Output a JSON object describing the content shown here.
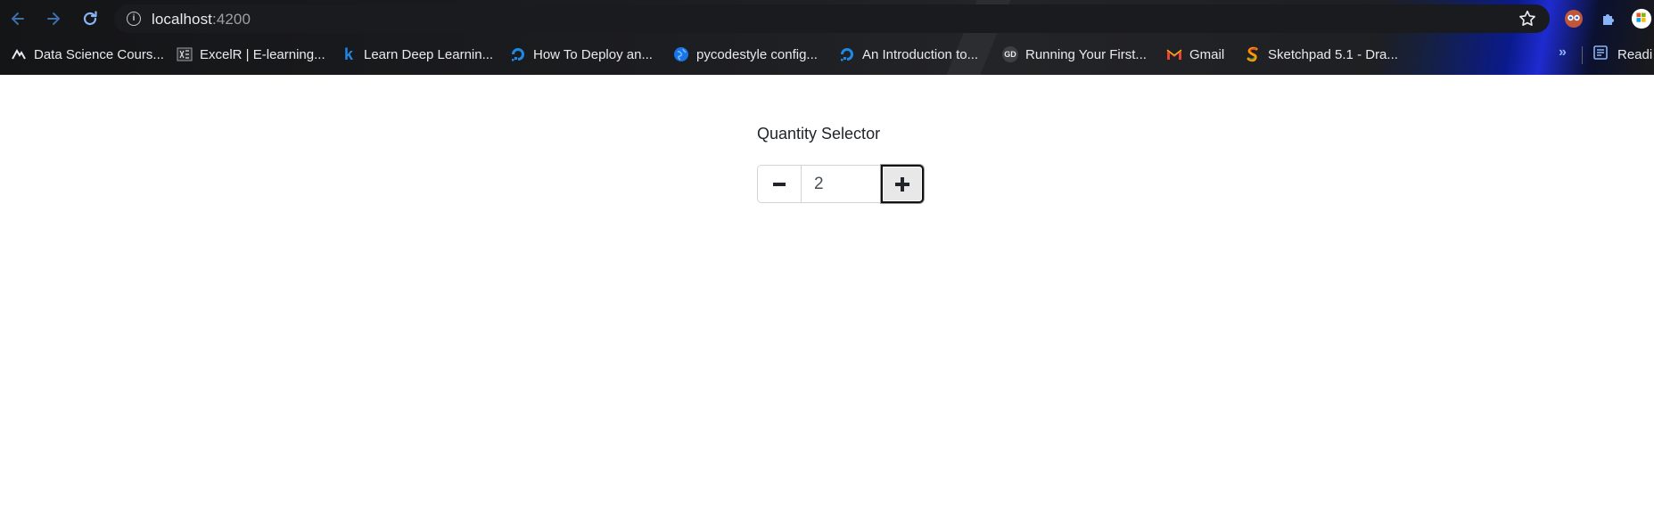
{
  "browser": {
    "url_host": "localhost",
    "url_port": ":4200",
    "bookmarks": [
      {
        "label": "Data Science Cours...",
        "icon": "data-science-favicon"
      },
      {
        "label": "ExcelR | E-learning...",
        "icon": "excelr-favicon"
      },
      {
        "label": "Learn Deep Learnin...",
        "icon": "k-favicon"
      },
      {
        "label": "How To Deploy an...",
        "icon": "digitalocean-favicon"
      },
      {
        "label": "pycodestyle config...",
        "icon": "globe-favicon"
      },
      {
        "label": "An Introduction to...",
        "icon": "digitalocean-favicon"
      },
      {
        "label": "Running Your First...",
        "icon": "gd-favicon"
      },
      {
        "label": "Gmail",
        "icon": "gmail-favicon"
      },
      {
        "label": "Sketchpad 5.1 - Dra...",
        "icon": "sketchpad-favicon"
      }
    ],
    "more_bookmarks": "»",
    "reading_list": "Readi",
    "k_glyph": "k",
    "gd_glyph": "GD"
  },
  "app": {
    "title": "Quantity Selector",
    "decrement_symbol": "−",
    "increment_symbol": "+",
    "quantity": "2"
  },
  "colors": {
    "chrome_bg": "#202124",
    "omnibox_bg": "#1a1b1e",
    "nav_blue": "#8ab4f8",
    "text_dark": "#212529",
    "border": "#ced4da"
  }
}
